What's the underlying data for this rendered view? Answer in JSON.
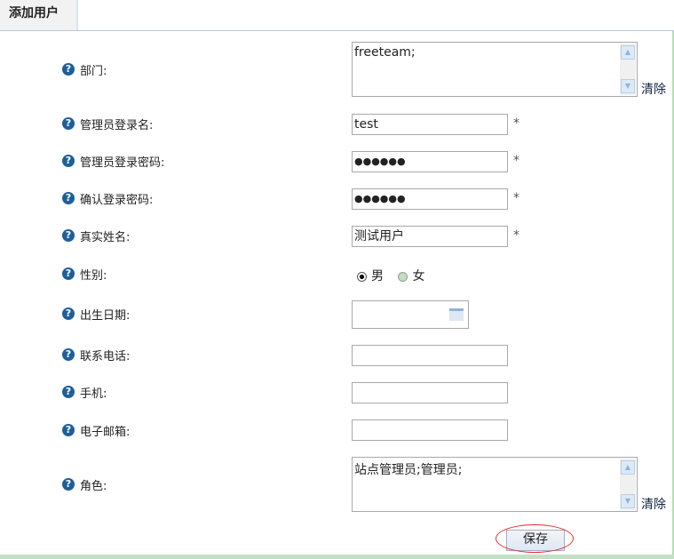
{
  "tab": "添加用户",
  "fields": {
    "dept": {
      "label": "部门:",
      "value": "freeteam;",
      "clear": "清除"
    },
    "login": {
      "label": "管理员登录名:",
      "value": "test",
      "required": "*"
    },
    "password": {
      "label": "管理员登录密码:",
      "value": "●●●●●●",
      "required": "*"
    },
    "confirm": {
      "label": "确认登录密码:",
      "value": "●●●●●●",
      "required": "*"
    },
    "realname": {
      "label": "真实姓名:",
      "value": "测试用户",
      "required": "*"
    },
    "gender": {
      "label": "性别:",
      "options": [
        "男",
        "女"
      ],
      "selected": "男"
    },
    "birthday": {
      "label": "出生日期:",
      "value": ""
    },
    "phone": {
      "label": "联系电话:",
      "value": ""
    },
    "mobile": {
      "label": "手机:",
      "value": ""
    },
    "email": {
      "label": "电子邮箱:",
      "value": ""
    },
    "role": {
      "label": "角色:",
      "value": "站点管理员;管理员;",
      "clear": "清除"
    }
  },
  "save": "保存"
}
